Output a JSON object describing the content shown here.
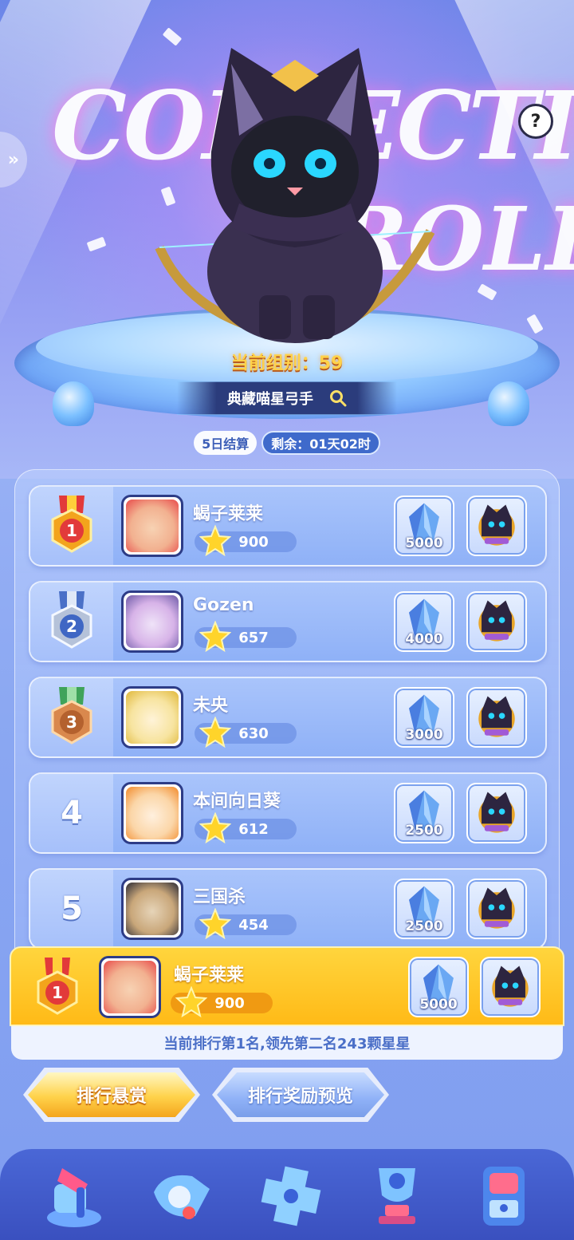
{
  "header": {
    "bg_text_line1": "COLLECTION",
    "bg_text_line2": "ROLL",
    "help_label": "?",
    "side_tab_label": "»",
    "group_label": "当前组别：59",
    "search_text": "典藏喵星弓手"
  },
  "settlement": {
    "cycle_label": "5日结算",
    "remaining_label": "剩余：01天02时"
  },
  "leaderboard": [
    {
      "rank": "1",
      "name": "蝎子莱莱",
      "score": "900",
      "crystal_count": "5000",
      "avatar_color": "#f2c8a6"
    },
    {
      "rank": "2",
      "name": "Gozen",
      "score": "657",
      "crystal_count": "4000",
      "avatar_color": "#d7b3e8"
    },
    {
      "rank": "3",
      "name": "未央",
      "score": "630",
      "crystal_count": "3000",
      "avatar_color": "#f7e4a0"
    },
    {
      "rank": "4",
      "name": "本间向日葵",
      "score": "612",
      "crystal_count": "2500",
      "avatar_color": "#fbd6a8"
    },
    {
      "rank": "5",
      "name": "三国杀",
      "score": "454",
      "crystal_count": "2500",
      "avatar_color": "#c9a77a"
    }
  ],
  "mine": {
    "rank": "1",
    "name": "蝎子莱莱",
    "score": "900",
    "crystal_count": "5000",
    "note": "当前排行第1名,领先第二名243颗星星"
  },
  "buttons": {
    "bounty_label": "排行悬赏",
    "preview_label": "排行奖励预览"
  },
  "tabs": [
    {
      "icon": "hammer-icon"
    },
    {
      "icon": "whistle-icon"
    },
    {
      "icon": "gamepad-icon"
    },
    {
      "icon": "trophy-icon"
    },
    {
      "icon": "gacha-machine-icon"
    }
  ],
  "colors": {
    "gold": "#ffc21f",
    "accent_blue": "#3f6acb",
    "row_blue": "#9db9f9"
  }
}
